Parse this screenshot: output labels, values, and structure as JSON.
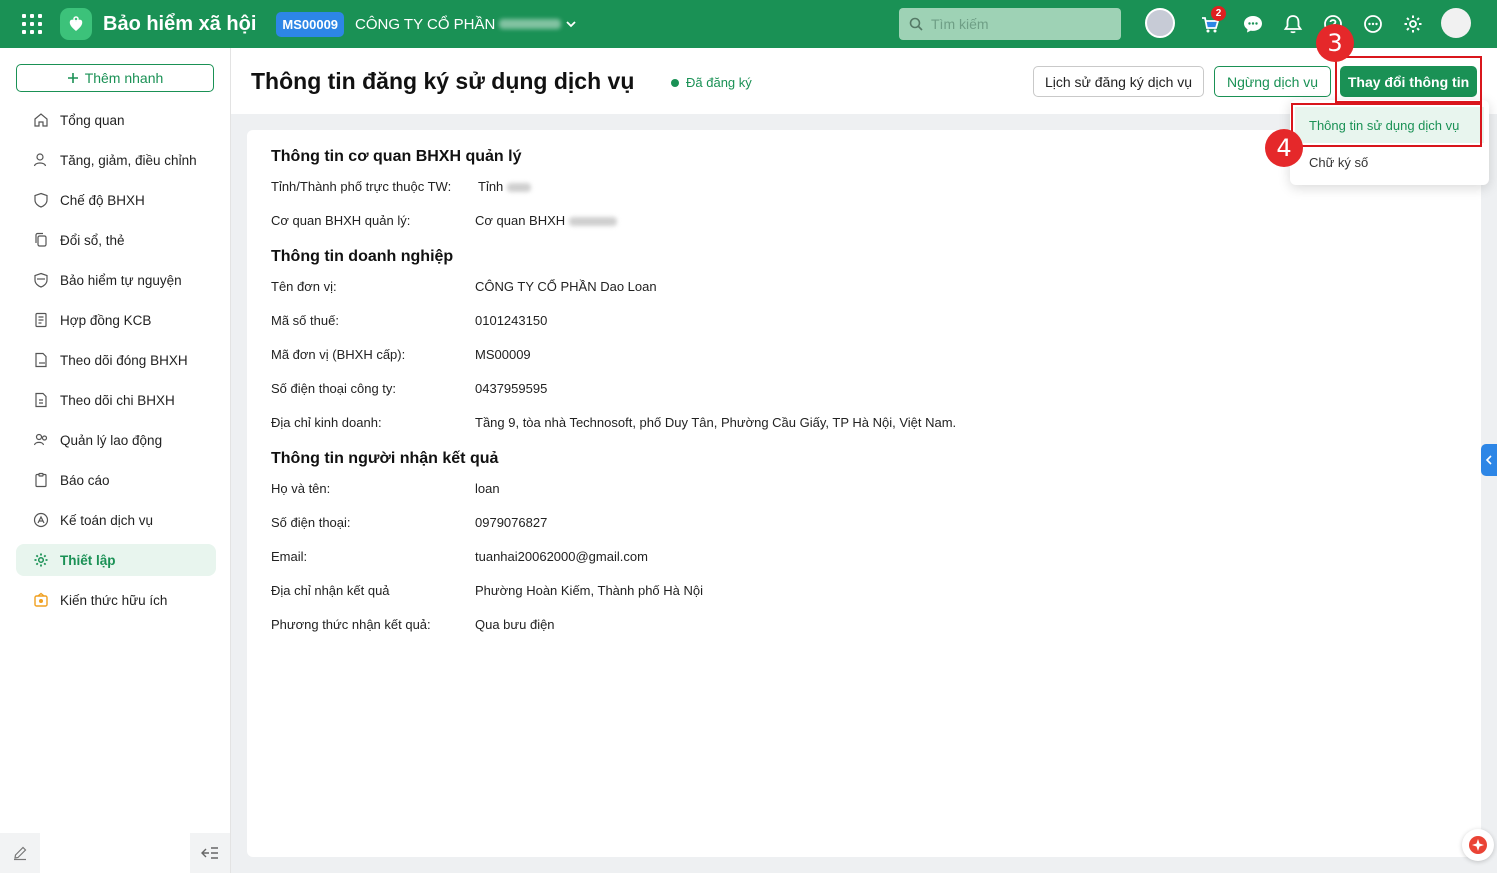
{
  "app": {
    "title": "Bảo hiểm xã hội",
    "org_code": "MS00009",
    "company_name": "CÔNG TY CỔ PHẦN",
    "search_placeholder": "Tìm kiếm",
    "cart_count": "2",
    "brand_color": "#1a9155"
  },
  "sidebar": {
    "quick_add": "Thêm nhanh",
    "items": [
      {
        "label": "Tổng quan",
        "icon": "home-icon"
      },
      {
        "label": "Tăng, giảm, điều chỉnh",
        "icon": "user-adjust-icon"
      },
      {
        "label": "Chế độ BHXH",
        "icon": "shield-heart-icon"
      },
      {
        "label": "Đổi sổ, thẻ",
        "icon": "copy-icon"
      },
      {
        "label": "Bảo hiểm tự nguyện",
        "icon": "shield-icon"
      },
      {
        "label": "Hợp đồng KCB",
        "icon": "contract-icon"
      },
      {
        "label": "Theo dõi đóng BHXH",
        "icon": "calendar-doc-icon"
      },
      {
        "label": "Theo dõi chi BHXH",
        "icon": "doc-money-icon"
      },
      {
        "label": "Quản lý lao động",
        "icon": "users-icon"
      },
      {
        "label": "Báo cáo",
        "icon": "report-icon"
      },
      {
        "label": "Kế toán dịch vụ",
        "icon": "accounting-icon"
      },
      {
        "label": "Thiết lập",
        "icon": "gear-icon",
        "active": true
      },
      {
        "label": "Kiến thức hữu ích",
        "icon": "knowledge-icon"
      }
    ]
  },
  "header": {
    "title": "Thông tin đăng ký sử dụng dịch vụ",
    "status": "Đã đăng ký",
    "history_button": "Lịch sử đăng ký dịch vụ",
    "stop_button": "Ngừng dịch vụ",
    "change_button": "Thay đổi thông tin"
  },
  "dropdown": {
    "items": [
      "Thông tin sử dụng dịch vụ",
      "Chữ ký số"
    ]
  },
  "annotations": {
    "step3": "3",
    "step4": "4"
  },
  "sections": {
    "agency": {
      "title": "Thông tin cơ quan BHXH quản lý",
      "rows": [
        {
          "label": "Tỉnh/Thành phố trực thuộc TW:",
          "value": "Tỉnh"
        },
        {
          "label": "Cơ quan BHXH quản lý:",
          "value": "Cơ quan BHXH"
        }
      ]
    },
    "company": {
      "title": "Thông tin doanh nghiệp",
      "rows": [
        {
          "label": "Tên đơn vị:",
          "value": "CÔNG TY CỔ PHẦN Dao Loan"
        },
        {
          "label": "Mã số thuế:",
          "value": "0101243150"
        },
        {
          "label": "Mã đơn vị (BHXH cấp):",
          "value": "MS00009"
        },
        {
          "label": "Số điện thoại công ty:",
          "value": "0437959595"
        },
        {
          "label": "Địa chỉ kinh doanh:",
          "value": "Tầng 9, tòa nhà Technosoft, phố Duy Tân, Phường Cầu Giấy, TP Hà Nội, Việt Nam."
        }
      ]
    },
    "recipient": {
      "title": "Thông tin người nhận kết quả",
      "rows": [
        {
          "label": "Họ và tên:",
          "value": "loan"
        },
        {
          "label": "Số điện thoại:",
          "value": "0979076827"
        },
        {
          "label": "Email:",
          "value": "tuanhai20062000@gmail.com"
        },
        {
          "label": "Địa chỉ nhận kết quả",
          "value": "Phường Hoàn Kiếm, Thành phố Hà Nội"
        },
        {
          "label": "Phương thức nhận kết quả:",
          "value": "Qua bưu điện"
        }
      ]
    }
  }
}
